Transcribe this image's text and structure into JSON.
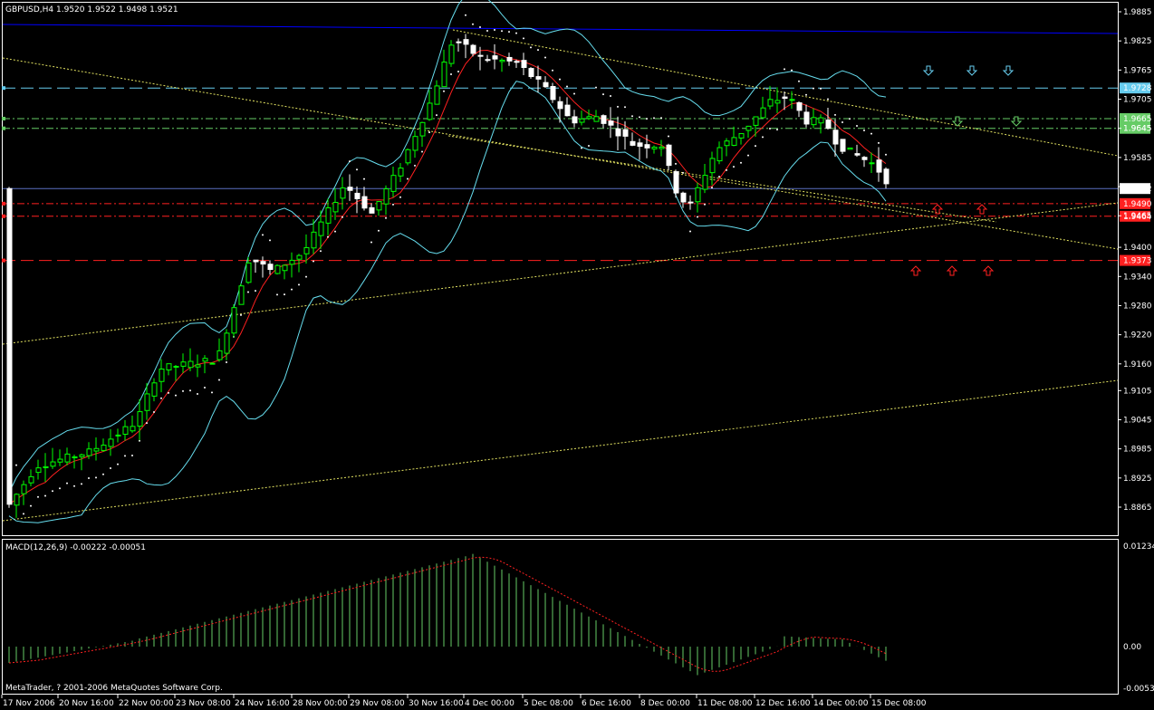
{
  "header": {
    "main_info": "GBPUSD,H4  1.9520 1.9522 1.9498 1.9521",
    "macd_info": "MACD(12,26,9) -0.00222 -0.00051",
    "copyright": "MetaTrader, ? 2001-2006 MetaQuotes Software Corp."
  },
  "colors": {
    "background": "#000000",
    "axis": "#ffffff",
    "bull": "#00ff00",
    "bear": "#ffffff",
    "bollinger": "#66ddee",
    "ma": "#ff2020",
    "sar": "#ffffff",
    "trendline": "#e0e060",
    "blue_line": "#0000ff",
    "cyan_level": "#66ccee",
    "green_level": "#66cc66",
    "red_level": "#ff2020",
    "macd_hist": "#66cc66",
    "macd_signal": "#ff2020"
  },
  "chart_data": {
    "type": "candlestick",
    "symbol": "GBPUSD",
    "timeframe": "H4",
    "ylim": [
      1.8835,
      1.9905
    ],
    "price_ticks": [
      "1.9885",
      "1.9825",
      "1.9765",
      "1.9705",
      "1.9645",
      "1.9585",
      "1.9525",
      "1.9465",
      "1.9400",
      "1.9340",
      "1.9280",
      "1.9220",
      "1.9160",
      "1.9105",
      "1.9045",
      "1.8985",
      "1.8925",
      "1.8865"
    ],
    "time_labels": [
      "17 Nov 2006",
      "20 Nov 16:00",
      "22 Nov 00:00",
      "23 Nov 08:00",
      "24 Nov 16:00",
      "28 Nov 00:00",
      "29 Nov 08:00",
      "30 Nov 16:00",
      "4 Dec 00:00",
      "5 Dec 08:00",
      "6 Dec 16:00",
      "8 Dec 00:00",
      "11 Dec 08:00",
      "12 Dec 16:00",
      "14 Dec 00:00",
      "15 Dec 08:00"
    ],
    "current_price": "1.9521",
    "levels": [
      {
        "price": "1.9728",
        "value": 1.9728,
        "style": "cyan-dash"
      },
      {
        "price": "1.9665",
        "value": 1.9665,
        "style": "green-dashdot"
      },
      {
        "price": "1.9645",
        "value": 1.9645,
        "style": "green-dashdot"
      },
      {
        "price": "1.9490",
        "value": 1.949,
        "style": "red-dashdot"
      },
      {
        "price": "1.9464",
        "value": 1.9464,
        "style": "red-dashdot"
      },
      {
        "price": "1.9373",
        "value": 1.9373,
        "style": "red-dash"
      }
    ],
    "macd": {
      "params": "MACD(12,26,9)",
      "value": -0.00222,
      "signal": -0.00051,
      "ylim": [
        -0.00531,
        0.01234
      ],
      "ticks": [
        "0.01234",
        "0.00",
        "-0.00531"
      ]
    }
  }
}
